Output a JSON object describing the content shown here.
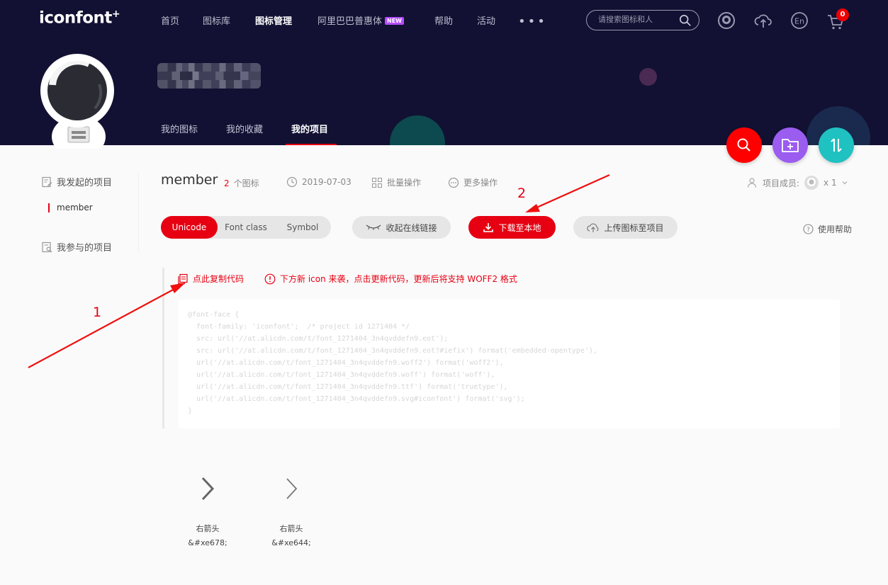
{
  "header": {
    "logo_text": "iconfont",
    "logo_mark": "+",
    "nav": [
      {
        "label": "首页"
      },
      {
        "label": "图标库"
      },
      {
        "label": "图标管理"
      },
      {
        "label": "阿里巴巴普惠体",
        "badge": "NEW"
      },
      {
        "label": "帮助"
      },
      {
        "label": "活动"
      }
    ],
    "more_dots": "•••",
    "search_placeholder": "请搜索图标和人",
    "lang_label": "En",
    "cart_count": "0"
  },
  "profile": {
    "subnav": [
      {
        "label": "我的图标"
      },
      {
        "label": "我的收藏"
      },
      {
        "label": "我的项目"
      }
    ]
  },
  "sidebar": {
    "initiated_label": "我发起的项目",
    "project_item": "member",
    "participated_label": "我参与的项目"
  },
  "project": {
    "title": "member",
    "icon_count": "2",
    "icon_count_unit": "个图标",
    "date": "2019-07-03",
    "batch_label": "批量操作",
    "more_label": "更多操作",
    "members_label": "项目成员:",
    "members_count": "x 1"
  },
  "toolbar": {
    "tabs": [
      {
        "label": "Unicode"
      },
      {
        "label": "Font class"
      },
      {
        "label": "Symbol"
      }
    ],
    "collapse_link": "收起在线链接",
    "download": "下载至本地",
    "upload": "上传图标至项目",
    "help": "使用帮助"
  },
  "code": {
    "copy_label": "点此复制代码",
    "notice": "下方新 icon 来袭，点击更新代码，更新后将支持 WOFF2 格式",
    "lines": [
      "@font-face {",
      "  font-family: 'iconfont';  /* project id 1271404 */",
      "  src: url('//at.alicdn.com/t/font_1271404_3n4qvddefn9.eot');",
      "  src: url('//at.alicdn.com/t/font_1271404_3n4qvddefn9.eot?#iefix') format('embedded-opentype'),",
      "  url('//at.alicdn.com/t/font_1271404_3n4qvddefn9.woff2') format('woff2'),",
      "  url('//at.alicdn.com/t/font_1271404_3n4qvddefn9.woff') format('woff'),",
      "  url('//at.alicdn.com/t/font_1271404_3n4qvddefn9.ttf') format('truetype'),",
      "  url('//at.alicdn.com/t/font_1271404_3n4qvddefn9.svg#iconfont') format('svg');",
      "}"
    ]
  },
  "icons": [
    {
      "name": "右箭头",
      "code": "&#xe678;",
      "icon": "chevron-right-bold-icon"
    },
    {
      "name": "右箭头",
      "code": "&#xe644;",
      "icon": "chevron-right-thin-icon"
    }
  ],
  "annotations": [
    {
      "label": "1"
    },
    {
      "label": "2"
    }
  ],
  "colors": {
    "header_bg": "#121133",
    "accent": "#e60012",
    "fab_search": "#ff0000",
    "fab_folder": "#9b5cf0",
    "fab_sort": "#1fc1c1"
  }
}
